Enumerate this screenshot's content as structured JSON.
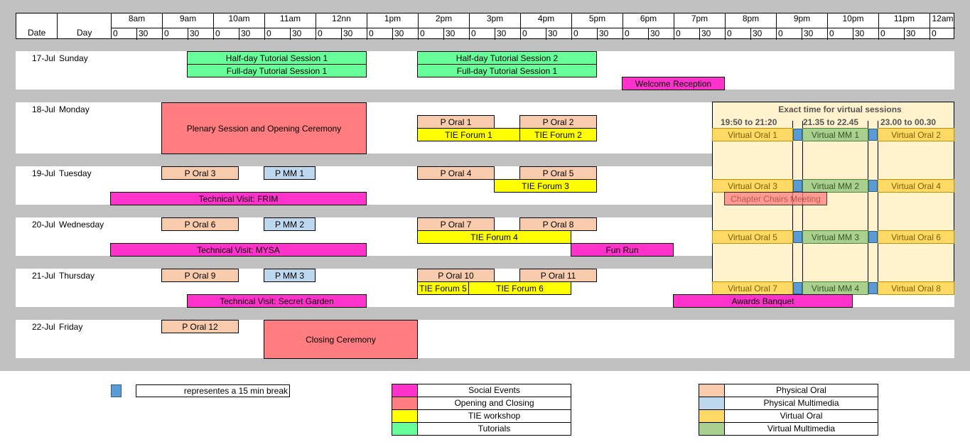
{
  "header": {
    "date_label": "Date",
    "day_label": "Day",
    "hours": [
      "8am",
      "9am",
      "10am",
      "11am",
      "12nn",
      "1pm",
      "2pm",
      "3pm",
      "4pm",
      "5pm",
      "6pm",
      "7pm",
      "8pm",
      "9pm",
      "10pm",
      "11pm",
      "12am"
    ],
    "half_zero": "0",
    "half_thirty": "30"
  },
  "days": [
    {
      "date": "17-Jul",
      "day": "Sunday"
    },
    {
      "date": "18-Jul",
      "day": "Monday"
    },
    {
      "date": "19-Jul",
      "day": "Tuesday"
    },
    {
      "date": "20-Jul",
      "day": "Wednesday"
    },
    {
      "date": "21-Jul",
      "day": "Thursday"
    },
    {
      "date": "22-Jul",
      "day": "Friday"
    }
  ],
  "colors": {
    "tutorial": "#66ff99",
    "social": "#ff33cc",
    "opening": "#ff7c80",
    "tie": "#ffff00",
    "phys_oral": "#f8cbad",
    "phys_mm": "#bdd7ee",
    "virt_oral": "#ffd966",
    "virt_mm": "#a9d08e",
    "break": "#5b9bd5"
  },
  "events": {
    "sun_tut1": "Half-day Tutorial Session 1",
    "sun_tut2": "Full-day Tutorial Session 1",
    "sun_tut3": "Half-day Tutorial Session 2",
    "sun_tut4": "Full-day Tutorial Session 1",
    "sun_welcome": "Welcome Reception",
    "mon_plenary": "Plenary Session and Opening Ceremony",
    "mon_po1": "P Oral 1",
    "mon_po2": "P Oral 2",
    "mon_tie1": "TIE Forum 1",
    "mon_tie2": "TIE Forum 2",
    "tue_po3": "P Oral 3",
    "tue_pmm1": "P MM 1",
    "tue_po4": "P Oral 4",
    "tue_po5": "P Oral 5",
    "tue_tie3": "TIE Forum 3",
    "tue_frim": "Technical Visit: FRIM",
    "wed_po6": "P Oral 6",
    "wed_pmm2": "P MM 2",
    "wed_po7": "P Oral 7",
    "wed_po8": "P Oral 8",
    "wed_tie4": "TIE Forum 4",
    "wed_mysa": "Technical Visit: MYSA",
    "wed_funrun": "Fun Run",
    "thu_po9": "P Oral 9",
    "thu_pmm3": "P MM 3",
    "thu_po10": "P Oral 10",
    "thu_po11": "P Oral 11",
    "thu_tie5": "TIE Forum 5",
    "thu_tie6": "TIE Forum 6",
    "thu_garden": "Technical Visit: Secret Garden",
    "thu_banquet": "Awards Banquet",
    "fri_po12": "P Oral 12",
    "fri_closing": "Closing Ceremony"
  },
  "virtual": {
    "title": "Exact time for virtual sessions",
    "slot1": "19:50 to 21:20",
    "slot2": "21.35 to 22.45",
    "slot3": "23.00 to 00.30",
    "vo1": "Virtual Oral 1",
    "vmm1": "Virtual MM 1",
    "vo2": "Virtual Oral 2",
    "vo3": "Virtual Oral 3",
    "vmm2": "Virtual MM 2",
    "vo4": "Virtual Oral 4",
    "chapter": "Chapter Chairs Meeting",
    "vo5": "Virtual Oral 5",
    "vmm3": "Virtual MM 3",
    "vo6": "Virtual Oral 6",
    "vo7": "Virtual Oral 7",
    "vmm4": "Virtual MM 4",
    "vo8": "Virtual Oral 8"
  },
  "legend": {
    "break": "representes a 15 min break",
    "social": "Social Events",
    "opening": "Opening and Closing",
    "tie": "TIE workshop",
    "tutorials": "Tutorials",
    "phys_oral": "Physical Oral",
    "phys_mm": "Physical Multimedia",
    "virt_oral": "Virtual Oral",
    "virt_mm": "Virtual Multimedia"
  }
}
